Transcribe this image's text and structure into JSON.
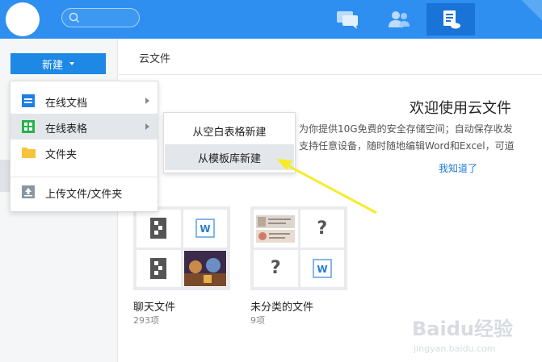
{
  "topbar": {
    "nav_icons": [
      "chat-icon",
      "contacts-icon",
      "files-icon"
    ],
    "active_icon": "files-icon",
    "accent_color": "#2f8ff0"
  },
  "sidebar": {
    "new_button_label": "新建"
  },
  "content": {
    "title": "云文件"
  },
  "welcome": {
    "title": "欢迎使用云文件",
    "line1": "为你提供10G免费的安全存储空间；自动保存收发",
    "line2": "支持任意设备，随时随地编辑Word和Excel，可道",
    "got_it": "我知道了"
  },
  "folders": [
    {
      "name": "聊天文件",
      "count": "293项"
    },
    {
      "name": "未分类的文件",
      "count": "9项"
    }
  ],
  "new_menu": {
    "items": [
      {
        "label": "在线文档",
        "icon": "doc-icon",
        "has_submenu": true
      },
      {
        "label": "在线表格",
        "icon": "sheet-icon",
        "has_submenu": true
      },
      {
        "label": "文件夹",
        "icon": "folder-icon",
        "has_submenu": false
      },
      {
        "label": "上传文件/文件夹",
        "icon": "upload-icon",
        "has_submenu": false
      }
    ]
  },
  "submenu": {
    "items": [
      {
        "label": "从空白表格新建"
      },
      {
        "label": "从模板库新建"
      }
    ]
  },
  "watermark": {
    "logo_text": "Baidu经验",
    "url_text": "jingyan.baidu.com"
  }
}
